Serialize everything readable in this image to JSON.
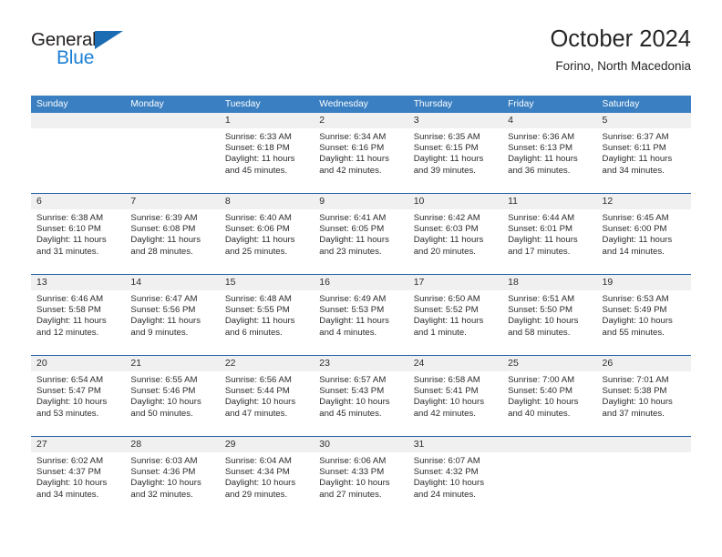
{
  "logo": {
    "word_top": "General",
    "word_bottom": "Blue",
    "triangle_color": "#1b6cb3",
    "blue_text_color": "#1b7fd4",
    "dark_text_color": "#231f20"
  },
  "header": {
    "title": "October 2024",
    "subtitle": "Forino, North Macedonia"
  },
  "theme": {
    "header_row_bg": "#3a7fc1",
    "week_separator": "#1b5fa4",
    "day_band_bg": "#f0f0f0",
    "text": "#2b2b2b"
  },
  "weekdays": [
    "Sunday",
    "Monday",
    "Tuesday",
    "Wednesday",
    "Thursday",
    "Friday",
    "Saturday"
  ],
  "weeks": [
    [
      {
        "day": "",
        "sunrise": "",
        "sunset": "",
        "daylight_line1": "",
        "daylight_line2": ""
      },
      {
        "day": "",
        "sunrise": "",
        "sunset": "",
        "daylight_line1": "",
        "daylight_line2": ""
      },
      {
        "day": "1",
        "sunrise": "Sunrise: 6:33 AM",
        "sunset": "Sunset: 6:18 PM",
        "daylight_line1": "Daylight: 11 hours",
        "daylight_line2": "and 45 minutes."
      },
      {
        "day": "2",
        "sunrise": "Sunrise: 6:34 AM",
        "sunset": "Sunset: 6:16 PM",
        "daylight_line1": "Daylight: 11 hours",
        "daylight_line2": "and 42 minutes."
      },
      {
        "day": "3",
        "sunrise": "Sunrise: 6:35 AM",
        "sunset": "Sunset: 6:15 PM",
        "daylight_line1": "Daylight: 11 hours",
        "daylight_line2": "and 39 minutes."
      },
      {
        "day": "4",
        "sunrise": "Sunrise: 6:36 AM",
        "sunset": "Sunset: 6:13 PM",
        "daylight_line1": "Daylight: 11 hours",
        "daylight_line2": "and 36 minutes."
      },
      {
        "day": "5",
        "sunrise": "Sunrise: 6:37 AM",
        "sunset": "Sunset: 6:11 PM",
        "daylight_line1": "Daylight: 11 hours",
        "daylight_line2": "and 34 minutes."
      }
    ],
    [
      {
        "day": "6",
        "sunrise": "Sunrise: 6:38 AM",
        "sunset": "Sunset: 6:10 PM",
        "daylight_line1": "Daylight: 11 hours",
        "daylight_line2": "and 31 minutes."
      },
      {
        "day": "7",
        "sunrise": "Sunrise: 6:39 AM",
        "sunset": "Sunset: 6:08 PM",
        "daylight_line1": "Daylight: 11 hours",
        "daylight_line2": "and 28 minutes."
      },
      {
        "day": "8",
        "sunrise": "Sunrise: 6:40 AM",
        "sunset": "Sunset: 6:06 PM",
        "daylight_line1": "Daylight: 11 hours",
        "daylight_line2": "and 25 minutes."
      },
      {
        "day": "9",
        "sunrise": "Sunrise: 6:41 AM",
        "sunset": "Sunset: 6:05 PM",
        "daylight_line1": "Daylight: 11 hours",
        "daylight_line2": "and 23 minutes."
      },
      {
        "day": "10",
        "sunrise": "Sunrise: 6:42 AM",
        "sunset": "Sunset: 6:03 PM",
        "daylight_line1": "Daylight: 11 hours",
        "daylight_line2": "and 20 minutes."
      },
      {
        "day": "11",
        "sunrise": "Sunrise: 6:44 AM",
        "sunset": "Sunset: 6:01 PM",
        "daylight_line1": "Daylight: 11 hours",
        "daylight_line2": "and 17 minutes."
      },
      {
        "day": "12",
        "sunrise": "Sunrise: 6:45 AM",
        "sunset": "Sunset: 6:00 PM",
        "daylight_line1": "Daylight: 11 hours",
        "daylight_line2": "and 14 minutes."
      }
    ],
    [
      {
        "day": "13",
        "sunrise": "Sunrise: 6:46 AM",
        "sunset": "Sunset: 5:58 PM",
        "daylight_line1": "Daylight: 11 hours",
        "daylight_line2": "and 12 minutes."
      },
      {
        "day": "14",
        "sunrise": "Sunrise: 6:47 AM",
        "sunset": "Sunset: 5:56 PM",
        "daylight_line1": "Daylight: 11 hours",
        "daylight_line2": "and 9 minutes."
      },
      {
        "day": "15",
        "sunrise": "Sunrise: 6:48 AM",
        "sunset": "Sunset: 5:55 PM",
        "daylight_line1": "Daylight: 11 hours",
        "daylight_line2": "and 6 minutes."
      },
      {
        "day": "16",
        "sunrise": "Sunrise: 6:49 AM",
        "sunset": "Sunset: 5:53 PM",
        "daylight_line1": "Daylight: 11 hours",
        "daylight_line2": "and 4 minutes."
      },
      {
        "day": "17",
        "sunrise": "Sunrise: 6:50 AM",
        "sunset": "Sunset: 5:52 PM",
        "daylight_line1": "Daylight: 11 hours",
        "daylight_line2": "and 1 minute."
      },
      {
        "day": "18",
        "sunrise": "Sunrise: 6:51 AM",
        "sunset": "Sunset: 5:50 PM",
        "daylight_line1": "Daylight: 10 hours",
        "daylight_line2": "and 58 minutes."
      },
      {
        "day": "19",
        "sunrise": "Sunrise: 6:53 AM",
        "sunset": "Sunset: 5:49 PM",
        "daylight_line1": "Daylight: 10 hours",
        "daylight_line2": "and 55 minutes."
      }
    ],
    [
      {
        "day": "20",
        "sunrise": "Sunrise: 6:54 AM",
        "sunset": "Sunset: 5:47 PM",
        "daylight_line1": "Daylight: 10 hours",
        "daylight_line2": "and 53 minutes."
      },
      {
        "day": "21",
        "sunrise": "Sunrise: 6:55 AM",
        "sunset": "Sunset: 5:46 PM",
        "daylight_line1": "Daylight: 10 hours",
        "daylight_line2": "and 50 minutes."
      },
      {
        "day": "22",
        "sunrise": "Sunrise: 6:56 AM",
        "sunset": "Sunset: 5:44 PM",
        "daylight_line1": "Daylight: 10 hours",
        "daylight_line2": "and 47 minutes."
      },
      {
        "day": "23",
        "sunrise": "Sunrise: 6:57 AM",
        "sunset": "Sunset: 5:43 PM",
        "daylight_line1": "Daylight: 10 hours",
        "daylight_line2": "and 45 minutes."
      },
      {
        "day": "24",
        "sunrise": "Sunrise: 6:58 AM",
        "sunset": "Sunset: 5:41 PM",
        "daylight_line1": "Daylight: 10 hours",
        "daylight_line2": "and 42 minutes."
      },
      {
        "day": "25",
        "sunrise": "Sunrise: 7:00 AM",
        "sunset": "Sunset: 5:40 PM",
        "daylight_line1": "Daylight: 10 hours",
        "daylight_line2": "and 40 minutes."
      },
      {
        "day": "26",
        "sunrise": "Sunrise: 7:01 AM",
        "sunset": "Sunset: 5:38 PM",
        "daylight_line1": "Daylight: 10 hours",
        "daylight_line2": "and 37 minutes."
      }
    ],
    [
      {
        "day": "27",
        "sunrise": "Sunrise: 6:02 AM",
        "sunset": "Sunset: 4:37 PM",
        "daylight_line1": "Daylight: 10 hours",
        "daylight_line2": "and 34 minutes."
      },
      {
        "day": "28",
        "sunrise": "Sunrise: 6:03 AM",
        "sunset": "Sunset: 4:36 PM",
        "daylight_line1": "Daylight: 10 hours",
        "daylight_line2": "and 32 minutes."
      },
      {
        "day": "29",
        "sunrise": "Sunrise: 6:04 AM",
        "sunset": "Sunset: 4:34 PM",
        "daylight_line1": "Daylight: 10 hours",
        "daylight_line2": "and 29 minutes."
      },
      {
        "day": "30",
        "sunrise": "Sunrise: 6:06 AM",
        "sunset": "Sunset: 4:33 PM",
        "daylight_line1": "Daylight: 10 hours",
        "daylight_line2": "and 27 minutes."
      },
      {
        "day": "31",
        "sunrise": "Sunrise: 6:07 AM",
        "sunset": "Sunset: 4:32 PM",
        "daylight_line1": "Daylight: 10 hours",
        "daylight_line2": "and 24 minutes."
      },
      {
        "day": "",
        "sunrise": "",
        "sunset": "",
        "daylight_line1": "",
        "daylight_line2": ""
      },
      {
        "day": "",
        "sunrise": "",
        "sunset": "",
        "daylight_line1": "",
        "daylight_line2": ""
      }
    ]
  ]
}
